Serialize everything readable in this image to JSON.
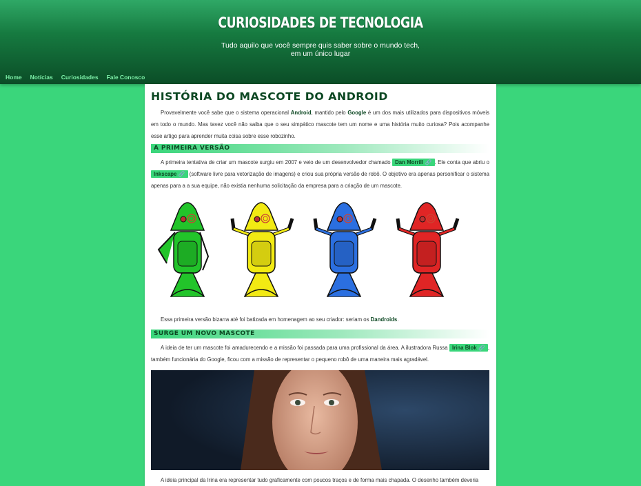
{
  "header": {
    "title": "CURIOSIDADES DE TECNOLOGIA",
    "subtitle": "Tudo aquilo que você sempre quis saber sobre o mundo tech, em um único lugar"
  },
  "nav": {
    "items": [
      "Home",
      "Notícias",
      "Curiosidades",
      "Fale Conosco"
    ]
  },
  "article": {
    "title": "HISTÓRIA DO MASCOTE DO ANDROID",
    "intro": {
      "t1": "Provavelmente você sabe que o sistema operacional ",
      "b1": "Android",
      "t2": ", mantido pelo ",
      "b2": "Google",
      "t3": " é um dos mais utilizados para dispositivos móveis em todo o mundo. Mas tavez você não saiba que o seu simpático mascote tem um nome e uma história muito curiosa? Pois acompanhe esse artigo para aprender muita coisa sobre esse robozinho."
    },
    "section1": {
      "heading": "A PRIMEIRA VERSÃO",
      "t1": "A primeira tentativa de criar um mascote surgiu em 2007 e veio de um desenvolvedor chamado ",
      "link1": "Dan Morrill 🔗",
      "t2": ". Ele conta que abriu o ",
      "link2": "Inkscape 🔗",
      "t3": " (software livre para vetorização de imagens) e criou sua própria versão de robô. O objetivo era apenas personificar o sistema apenas para a a sua equipe, não existia nenhuma solicitação da empresa para a criação de um mascote.",
      "caption_t": "Essa primeira versão bizarra até foi batizada em homenagem ao seu criador: seriam os ",
      "caption_b": "Dandroids",
      "caption_end": "."
    },
    "section2": {
      "heading": "SURGE UM NOVO MASCOTE",
      "t1": "A ideia de ter um mascote foi amadurecendo e a missão foi passada para uma profissional da área. A ilustradora Russa ",
      "link1": "Irina Blok 🔗",
      "t2": ", também funcionária do Google, ficou com a missão de representar o pequeno robô de uma maneira mais agradável.",
      "t3": "A ideia principal da Irina era representar tudo graficamente com poucos traços e de forma mais chapada. O desenho também deveria"
    },
    "robot_colors": [
      "#22c42a",
      "#f2ea13",
      "#2b6fe0",
      "#e02525"
    ]
  }
}
